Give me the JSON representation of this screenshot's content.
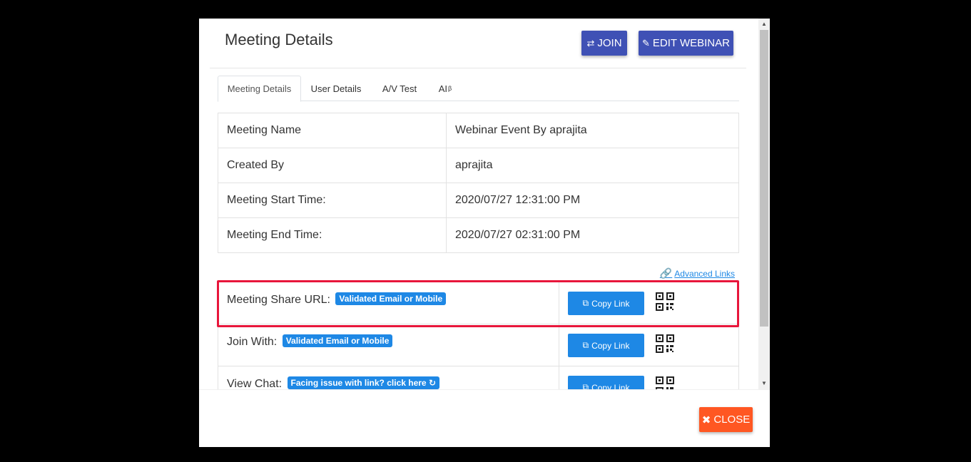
{
  "modal": {
    "title": "Meeting Details",
    "join_icon": "retweet-icon",
    "join_label": "JOIN",
    "edit_icon": "edit-icon",
    "edit_label": "EDIT WEBINAR"
  },
  "tabs": [
    {
      "label": "Meeting Details",
      "active": true
    },
    {
      "label": "User Details",
      "active": false
    },
    {
      "label": "A/V Test",
      "active": false
    },
    {
      "label": "AI",
      "sup": "β",
      "active": false
    }
  ],
  "details": [
    {
      "key": "Meeting Name",
      "value": "Webinar Event By aprajita"
    },
    {
      "key": "Created By",
      "value": "aprajita"
    },
    {
      "key": "Meeting Start Time:",
      "value": "2020/07/27 12:31:00 PM"
    },
    {
      "key": "Meeting End Time:",
      "value": "2020/07/27 02:31:00 PM"
    }
  ],
  "advanced_links": {
    "label": "Advanced Links",
    "icon": "link-icon"
  },
  "links": [
    {
      "label": "Meeting Share URL:",
      "badge": "Validated Email or Mobile",
      "button": "Copy Link",
      "highlighted": true
    },
    {
      "label": "Join With:",
      "badge": "Validated Email or Mobile",
      "button": "Copy Link",
      "highlighted": false
    },
    {
      "label": "View Chat:",
      "badge": "Facing issue with link? click here",
      "button": "Copy Link",
      "highlighted": false
    }
  ],
  "footer": {
    "close_label": "CLOSE",
    "close_icon": "times-icon"
  },
  "colors": {
    "primary": "#3f51b5",
    "accent": "#1e88e5",
    "close": "#ff5722",
    "highlight": "#e8163b"
  }
}
